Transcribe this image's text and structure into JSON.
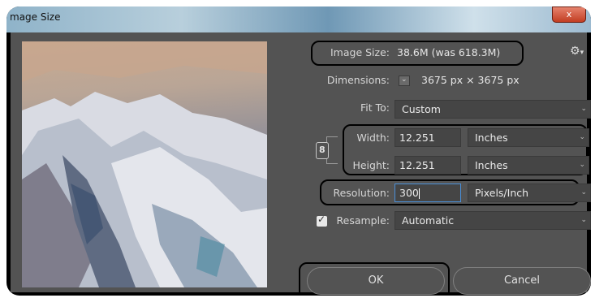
{
  "window": {
    "title": "mage Size",
    "close_glyph": "x"
  },
  "image_size": {
    "label": "Image Size:",
    "value": "38.6M (was 618.3M)"
  },
  "dimensions": {
    "label": "Dimensions:",
    "value": "3675 px  ×  3675 px"
  },
  "fit_to": {
    "label": "Fit To:",
    "value": "Custom"
  },
  "width": {
    "label": "Width:",
    "value": "12.251",
    "unit": "Inches"
  },
  "height": {
    "label": "Height:",
    "value": "12.251",
    "unit": "Inches"
  },
  "resolution": {
    "label": "Resolution:",
    "value": "300",
    "unit": "Pixels/Inch"
  },
  "resample": {
    "label": "Resample:",
    "value": "Automatic",
    "checked": true
  },
  "buttons": {
    "ok": "OK",
    "cancel": "Cancel"
  },
  "colors": {
    "panel": "#535353",
    "field": "#454545",
    "text": "#e6e6e6",
    "accent": "#4a90d9"
  }
}
